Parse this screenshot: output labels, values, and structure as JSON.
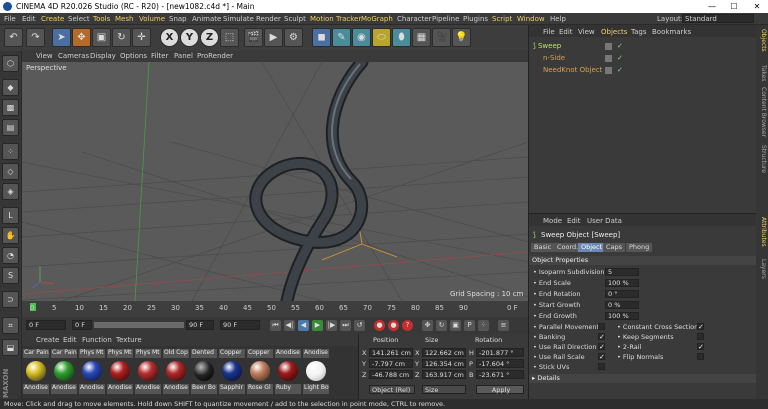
{
  "window": {
    "title": "CINEMA 4D R20.026 Studio (RC - R20) - [new1082.c4d *] - Main",
    "min": "—",
    "max": "☐",
    "close": "✕"
  },
  "menu": [
    "File",
    "Edit",
    "Create",
    "Select",
    "Tools",
    "Mesh",
    "Volume",
    "Snap",
    "Animate",
    "Simulate",
    "Render",
    "Sculpt",
    "Motion Tracker",
    "MoGraph",
    "Character",
    "Pipeline",
    "Plugins",
    "Script",
    "Window",
    "Help"
  ],
  "layout": {
    "label": "Layout:",
    "value": "Standard"
  },
  "toolbar": {
    "axes": [
      "X",
      "Y",
      "Z"
    ]
  },
  "viewport": {
    "menu": [
      "View",
      "Cameras",
      "Display",
      "Options",
      "Filter",
      "Panel",
      "ProRender"
    ],
    "camera": "Perspective",
    "grid_spacing": "Grid Spacing : 10 cm"
  },
  "timeline": {
    "ticks": [
      "0",
      "5",
      "10",
      "15",
      "20",
      "25",
      "30",
      "35",
      "40",
      "45",
      "50",
      "55",
      "60",
      "65",
      "70",
      "75",
      "80",
      "85",
      "90"
    ],
    "end_label": "0 F"
  },
  "transport": {
    "current": "0 F",
    "start": "0 F",
    "end": "90 F",
    "end2": "90 F"
  },
  "materials": {
    "menu": [
      "Create",
      "Edit",
      "Function",
      "Texture"
    ],
    "items": [
      {
        "top": "Car Pain",
        "bottom": "Anodise",
        "color": "#d8c020"
      },
      {
        "top": "Car Pain",
        "bottom": "Anodise",
        "color": "#2fa030"
      },
      {
        "top": "Phys Mt",
        "bottom": "Anodise",
        "color": "#2848b8"
      },
      {
        "top": "Phys Mt",
        "bottom": "Anodise",
        "color": "#b02020"
      },
      {
        "top": "Phys Mt",
        "bottom": "Anodise",
        "color": "#b83030"
      },
      {
        "top": "Old Cop",
        "bottom": "Anodise",
        "color": "#b02828"
      },
      {
        "top": "Dented",
        "bottom": "Beer Bo",
        "color": "#222222"
      },
      {
        "top": "Copper",
        "bottom": "Sapphir",
        "color": "#1a3590"
      },
      {
        "top": "Copper",
        "bottom": "Rose Gl",
        "color": "#c08060"
      },
      {
        "top": "Anodise",
        "bottom": "Ruby",
        "color": "#a01a1a"
      },
      {
        "top": "Anodise",
        "bottom": "Light Bo",
        "color": "#f0f0f0"
      }
    ]
  },
  "coords": {
    "headers": [
      "Position",
      "Size",
      "Rotation"
    ],
    "rows": [
      {
        "axis": "X",
        "pos": "141.261 cm",
        "size": "122.662 cm",
        "rl": "H",
        "rot": "-201.877 °"
      },
      {
        "axis": "Y",
        "pos": "-7.797 cm",
        "size": "126.354 cm",
        "rl": "P",
        "rot": "-17.604 °"
      },
      {
        "axis": "Z",
        "pos": "-46.788 cm",
        "size": "163.917 cm",
        "rl": "B",
        "rot": "-23.671 °"
      }
    ],
    "mode": "Object (Rel)",
    "size_mode": "Size",
    "apply": "Apply"
  },
  "objects": {
    "menu": [
      "File",
      "Edit",
      "View",
      "Objects",
      "Tags",
      "Bookmarks"
    ],
    "items": [
      {
        "name": "Sweep",
        "color": "#b5e86a"
      },
      {
        "name": "n-Side",
        "color": "#d8a050"
      },
      {
        "name": "NeedKnot Object",
        "color": "#d8a050"
      }
    ]
  },
  "attributes": {
    "menu": [
      "Mode",
      "Edit",
      "User Data"
    ],
    "object": "Sweep Object [Sweep]",
    "tabs": [
      "Basic",
      "Coord.",
      "Object",
      "Caps",
      "Phong"
    ],
    "active_tab": "Object",
    "section": "Object Properties",
    "props": [
      {
        "label": "Isoparm Subdivision",
        "value": "5"
      },
      {
        "label": "End Scale",
        "value": "100 %"
      },
      {
        "label": "End Rotation",
        "value": "0 °"
      },
      {
        "label": "Start Growth",
        "value": "0 %"
      },
      {
        "label": "End Growth",
        "value": "100 %"
      }
    ],
    "checks_left": [
      {
        "label": "Parallel Movement",
        "checked": ""
      },
      {
        "label": "Banking",
        "checked": "✓"
      },
      {
        "label": "Use Rail Direction",
        "checked": "✓"
      },
      {
        "label": "Use Rail Scale",
        "checked": "✓"
      },
      {
        "label": "Stick UVs",
        "checked": ""
      }
    ],
    "checks_right": [
      {
        "label": "Constant Cross Section",
        "checked": "✓"
      },
      {
        "label": "Keep Segments",
        "checked": ""
      },
      {
        "label": "2-Rail",
        "checked": "✓"
      },
      {
        "label": "Flip Normals",
        "checked": ""
      }
    ],
    "details": "Details"
  },
  "side_tabs": [
    "Objects",
    "Takes",
    "Content Browser",
    "Structure",
    "Attributes",
    "Layers"
  ],
  "status": "Move: Click and drag to move elements. Hold down SHIFT to quantize movement / add to the selection in point mode, CTRL to remove."
}
